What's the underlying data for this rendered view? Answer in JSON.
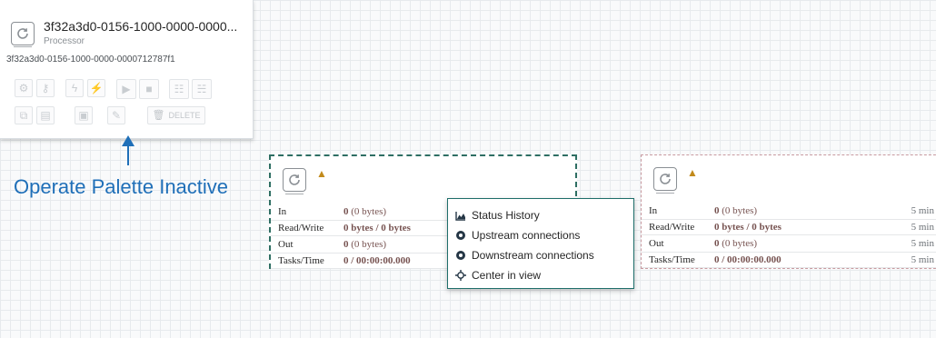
{
  "palette": {
    "name": "3f32a3d0-0156-1000-0000-0000...",
    "type": "Processor",
    "id": "3f32a3d0-0156-1000-0000-0000712787f1",
    "delete_label": "DELETE"
  },
  "annotation": {
    "text": "Operate Palette Inactive",
    "color": "#1f6fb8"
  },
  "processors": [
    {
      "rows": [
        {
          "label": "In",
          "value_bold": "0",
          "value_rest": " (0 bytes)",
          "duration": ""
        },
        {
          "label": "Read/Write",
          "value_bold": "0 bytes / 0 bytes",
          "value_rest": "",
          "duration": ""
        },
        {
          "label": "Out",
          "value_bold": "0",
          "value_rest": " (0 bytes)",
          "duration": ""
        },
        {
          "label": "Tasks/Time",
          "value_bold": "0 / 00:00:00.000",
          "value_rest": "",
          "duration": ""
        }
      ]
    },
    {
      "rows": [
        {
          "label": "In",
          "value_bold": "0",
          "value_rest": " (0 bytes)",
          "duration": "5 min"
        },
        {
          "label": "Read/Write",
          "value_bold": "0 bytes / 0 bytes",
          "value_rest": "",
          "duration": "5 min"
        },
        {
          "label": "Out",
          "value_bold": "0",
          "value_rest": " (0 bytes)",
          "duration": "5 min"
        },
        {
          "label": "Tasks/Time",
          "value_bold": "0 / 00:00:00.000",
          "value_rest": "",
          "duration": "5 min"
        }
      ]
    }
  ],
  "context_menu": {
    "items": [
      {
        "label": "Status History",
        "icon": "area-chart-icon"
      },
      {
        "label": "Upstream connections",
        "icon": "circle-arrow-up-icon"
      },
      {
        "label": "Downstream connections",
        "icon": "circle-arrow-down-icon"
      },
      {
        "label": "Center in view",
        "icon": "crosshair-icon"
      }
    ]
  },
  "colors": {
    "selected_border": "#2e6e63",
    "warning": "#c28a1b",
    "value_text": "#775351"
  }
}
